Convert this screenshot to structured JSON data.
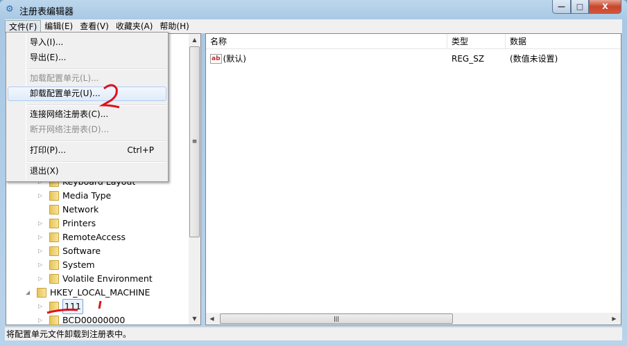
{
  "window": {
    "title": "注册表编辑器",
    "controls": {
      "minimize": "—",
      "maximize": "□",
      "close": "X"
    }
  },
  "menubar": [
    "文件(F)",
    "编辑(E)",
    "查看(V)",
    "收藏夹(A)",
    "帮助(H)"
  ],
  "file_menu": {
    "items": [
      {
        "label": "导入(I)...",
        "disabled": false
      },
      {
        "label": "导出(E)...",
        "disabled": false
      },
      {
        "label": "加载配置单元(L)...",
        "disabled": true
      },
      {
        "label": "卸载配置单元(U)...",
        "disabled": false,
        "hovered": true
      },
      {
        "label": "连接网络注册表(C)...",
        "disabled": false
      },
      {
        "label": "断开网络注册表(D)...",
        "disabled": true
      },
      {
        "label": "打印(P)...",
        "shortcut": "Ctrl+P",
        "disabled": false
      },
      {
        "label": "退出(X)",
        "disabled": false
      }
    ]
  },
  "tree": {
    "items": [
      {
        "label": "Keyboard Layout"
      },
      {
        "label": "Media Type"
      },
      {
        "label": "Network"
      },
      {
        "label": "Printers"
      },
      {
        "label": "RemoteAccess"
      },
      {
        "label": "Software"
      },
      {
        "label": "System"
      },
      {
        "label": "Volatile Environment"
      },
      {
        "label": "HKEY_LOCAL_MACHINE"
      },
      {
        "label": "111",
        "selected": true
      },
      {
        "label": "BCD00000000"
      }
    ]
  },
  "values": {
    "columns": [
      "名称",
      "类型",
      "数据"
    ],
    "rows": [
      {
        "name": "(默认)",
        "type": "REG_SZ",
        "data": "(数值未设置)",
        "icon": "string-value-icon"
      }
    ]
  },
  "status": "将配置单元文件卸载到注册表中。",
  "annotations": {
    "step1": "1",
    "step2": "2",
    "color": "#e0101a"
  }
}
